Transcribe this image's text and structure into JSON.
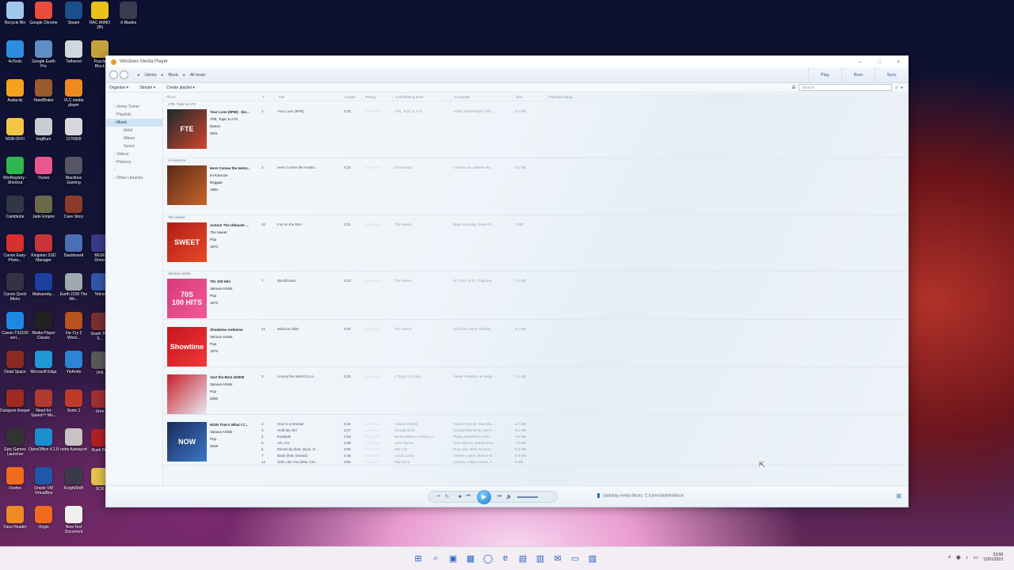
{
  "desktop_icons": [
    {
      "label": "Recycle Bin",
      "color": "#a0c8ec"
    },
    {
      "label": "Google Chrome",
      "color": "#e94c3d"
    },
    {
      "label": "Steam",
      "color": "#1b4f8a"
    },
    {
      "label": "RAC ANNO 2IN",
      "color": "#e8c21a"
    },
    {
      "label": "X-Blades",
      "color": "#3a3a52"
    },
    {
      "label": "4uTools",
      "color": "#2d8ee0"
    },
    {
      "label": "Google Earth Pro",
      "color": "#5f8fc6"
    },
    {
      "label": "Tethered",
      "color": "#cfd6de"
    },
    {
      "label": "Puzzle Block",
      "color": "#c4a33c"
    },
    {
      "label": "Audacity",
      "color": "#f4a21d"
    },
    {
      "label": "HandBrake",
      "color": "#9a5b2c"
    },
    {
      "label": "VLC media player",
      "color": "#f08a1d"
    },
    {
      "label": "NOB-OFFI",
      "color": "#f4c646"
    },
    {
      "label": "ImgBurn",
      "color": "#c9ccd2"
    },
    {
      "label": "1170809",
      "color": "#d8d8dc"
    },
    {
      "label": "WinRegistry - Shortcut",
      "color": "#2fb84e"
    },
    {
      "label": "iTunes",
      "color": "#e9578f"
    },
    {
      "label": "Blackbox Gaming",
      "color": "#555566"
    },
    {
      "label": "Cambtube",
      "color": "#303846"
    },
    {
      "label": "Jade Empire",
      "color": "#6b6a48"
    },
    {
      "label": "Cave Story",
      "color": "#8a3a2a"
    },
    {
      "label": "Canon Easy-Photo...",
      "color": "#d8302c"
    },
    {
      "label": "Kingston SSD Manager",
      "color": "#c8343a"
    },
    {
      "label": "Dashboard",
      "color": "#4b6fb5"
    },
    {
      "label": "BESK Driver",
      "color": "#3a3a8a"
    },
    {
      "label": "Canon Quick Menu",
      "color": "#333344"
    },
    {
      "label": "Malwareby...",
      "color": "#1c3fa0"
    },
    {
      "label": "Earth 2150 The Mo...",
      "color": "#a0a8b0"
    },
    {
      "label": "Tekno",
      "color": "#3355aa"
    },
    {
      "label": "Canon TS3100 seri...",
      "color": "#1e88e5"
    },
    {
      "label": "Media Player Classic",
      "color": "#222222"
    },
    {
      "label": "Far Cry 2 Word...",
      "color": "#b8521e"
    },
    {
      "label": "South The S...",
      "color": "#7a3030"
    },
    {
      "label": "Dead Space",
      "color": "#8a2a20"
    },
    {
      "label": "Microsoft Edge",
      "color": "#1f9ad6"
    },
    {
      "label": "YinAride",
      "color": "#2d84d6"
    },
    {
      "label": "Unit",
      "color": "#5a5a5a"
    },
    {
      "label": "Dungeon Keeper",
      "color": "#a02a20"
    },
    {
      "label": "Need for Speed™ Mo...",
      "color": "#b03a30"
    },
    {
      "label": "Sonic 1",
      "color": "#c03a2a"
    },
    {
      "label": "Unre",
      "color": "#a03030"
    },
    {
      "label": "Epic Games Launcher",
      "color": "#333333"
    },
    {
      "label": "OpenOffice 4.1.8",
      "color": "#1a8fd0"
    },
    {
      "label": "nebo Autosport",
      "color": "#c9c2c2"
    },
    {
      "label": "Rush Pro",
      "color": "#b02020"
    },
    {
      "label": "Firefox",
      "color": "#f26a1b"
    },
    {
      "label": "Oracle VM VirtualBox",
      "color": "#1f58a8"
    },
    {
      "label": "KnightShift",
      "color": "#3a3a4a"
    },
    {
      "label": "SCR",
      "color": "#e4c24a"
    },
    {
      "label": "Face Header",
      "color": "#f08a22"
    },
    {
      "label": "Origin",
      "color": "#f26a1b"
    },
    {
      "label": "New Text Document",
      "color": "#f0f0f0"
    }
  ],
  "window": {
    "title": "Windows Media Player",
    "breadcrumb": [
      "Library",
      "Music",
      "All music"
    ],
    "tabs": [
      "Play",
      "Burn",
      "Sync"
    ],
    "commands": [
      "Organize ▾",
      "Stream ▾",
      "Create playlist ▾"
    ],
    "search_placeholder": "Search",
    "nav": [
      {
        "label": "Jonny Turner",
        "sel": false,
        "indent": 0
      },
      {
        "label": "Playlists",
        "sel": false,
        "indent": 0
      },
      {
        "label": "Music",
        "sel": true,
        "indent": 0
      },
      {
        "label": "Artist",
        "sel": false,
        "indent": 1
      },
      {
        "label": "Album",
        "sel": false,
        "indent": 1
      },
      {
        "label": "Genre",
        "sel": false,
        "indent": 1
      },
      {
        "label": "Videos",
        "sel": false,
        "indent": 0
      },
      {
        "label": "Pictures",
        "sel": false,
        "indent": 0
      },
      {
        "label": "",
        "sel": false,
        "indent": 0
      },
      {
        "label": "Other Libraries",
        "sel": false,
        "indent": 0
      }
    ],
    "columns": [
      "Album",
      "#",
      "Title",
      "Length",
      "Rating",
      "Contributing artist",
      "Composer",
      "Size",
      "Parental rating"
    ]
  },
  "albums": [
    {
      "group": "ATB, Topic & A7S",
      "title": "Your Love (9PM) - Sin...",
      "artist": "ATB, Topic & A7S",
      "genre": "Dance",
      "year": "2021",
      "art": [
        "#1c2a2e",
        "#d2452c"
      ],
      "art_text": "FTE",
      "tracks": [
        {
          "n": "1",
          "title": "Your Love (9PM)",
          "len": "2:30",
          "artist": "ATB, Topic & A7S",
          "composer": "Andre Tanneberger, Tob...",
          "size": "5.2 MB"
        }
      ]
    },
    {
      "group": "Ini Kamoze",
      "title": "Here Comes the Hotst...",
      "artist": "Ini Kamoze",
      "genre": "Reggae",
      "year": "1994",
      "art": [
        "#5a2a18",
        "#c8642a"
      ],
      "art_text": "",
      "tracks": [
        {
          "n": "2",
          "title": "Here Comes the Hotste...",
          "len": "4:10",
          "artist": "Ini Kamoze",
          "composer": "Ini Kamoze, Salaam Re...",
          "size": "9.2 MB"
        }
      ]
    },
    {
      "group": "The Sweet",
      "title": "Action! The Ultimate ...",
      "artist": "The Sweet",
      "genre": "Pop",
      "year": "1974",
      "art": [
        "#b01c14",
        "#e84a2a"
      ],
      "art_text": "SWEET",
      "tracks": [
        {
          "n": "10",
          "title": "Fox on the Run",
          "len": "3:21",
          "artist": "The Sweet",
          "composer": "Brian Connolly, Steve Pr...",
          "size": "7 MB"
        }
      ]
    },
    {
      "group": "Various Artists",
      "title": "70s 100 Hits",
      "artist": "Various Artists",
      "genre": "Pop",
      "year": "1973",
      "art": [
        "#d83a7a",
        "#f25a96"
      ],
      "art_text": "70S\n100 HITS",
      "tracks": [
        {
          "n": "7",
          "title": "Blockbuster",
          "len": "3:13",
          "artist": "The Sweet",
          "composer": "M. Chinn & M. Chapman",
          "size": "7.2 MB"
        }
      ]
    },
    {
      "group": "",
      "title": "Showtime Anthems",
      "artist": "Various Artists",
      "genre": "Pop",
      "year": "1973",
      "art": [
        "#c8141c",
        "#ee3a3a"
      ],
      "art_text": "Showtime",
      "tracks": [
        {
          "n": "22",
          "title": "Ballroom Blitz",
          "len": "4:02",
          "artist": "The Sweet",
          "composer": "Nicholas Chinn, Michae...",
          "size": "9.1 MB"
        }
      ]
    },
    {
      "group": "",
      "title": "Just the Best 4/2000",
      "artist": "Various Artists",
      "genre": "Pop",
      "year": "2000",
      "art": [
        "#c8202c",
        "#e8e8f0"
      ],
      "art_text": "",
      "tracks": [
        {
          "n": "3",
          "title": "Around the World (La L...",
          "len": "3:25",
          "artist": "A Touch of Class",
          "composer": "Alexei Potashov & Serge...",
          "size": "7.4 MB"
        }
      ]
    },
    {
      "group": "",
      "title": "NOW That's What I C...",
      "artist": "Various Artists",
      "genre": "Pop",
      "year": "2019",
      "art": [
        "#1a2a5a",
        "#3a78c8"
      ],
      "art_text": "NOW",
      "tracks": [
        {
          "n": "2",
          "title": "God Is a Woman",
          "len": "3:16",
          "artist": "Ariana Grande",
          "composer": "Ariana Grande, Max Ma...",
          "size": "6.7 MB"
        },
        {
          "n": "3",
          "title": "Hold My Girl",
          "len": "3:37",
          "artist": "George Ezra",
          "composer": "George Barnett & Joel P...",
          "size": "8.2 MB"
        },
        {
          "n": "4",
          "title": "Eastside",
          "len": "2:53",
          "artist": "Benny Blanco, Halsey, K...",
          "composer": "Pollay, Benjamin Levin...",
          "size": "5.9 MB"
        },
        {
          "n": "5",
          "title": "All I Am",
          "len": "3:39",
          "artist": "Jess Glynne",
          "composer": "Jess Glynne, Sandy Rive...",
          "size": "7.4 MB"
        },
        {
          "n": "6",
          "title": "Electricity (feat. Diplo, D...",
          "len": "3:59",
          "artist": "Silk City",
          "composer": "Dua Lipa, Mark Ronson,...",
          "size": "8.3 MB"
        },
        {
          "n": "7",
          "title": "Body (feat. brando)",
          "len": "2:46",
          "artist": "Loud Luxury",
          "composer": "Ceaser Lopes, Marlon M...",
          "size": "5.8 MB"
        },
        {
          "n": "12",
          "title": "Girls Like You (feat. Car...",
          "len": "3:55",
          "artist": "Maroon 5",
          "composer": "Cardi B, Adam Levine, J...",
          "size": "8 MB"
        }
      ]
    }
  ],
  "player": {
    "status": "Updating media library: C:\\Users\\Admin\\Music",
    "buttons": [
      "⥇",
      "↻",
      "■",
      "⏮",
      "▶",
      "⏭",
      "🔈"
    ]
  },
  "taskbar": {
    "icons": [
      "⊞",
      "⌕",
      "▣",
      "▦",
      "◯",
      "e",
      "▤",
      "▥",
      "✉",
      "▭",
      "▧"
    ],
    "time": "23:58",
    "date": "12/01/2023"
  }
}
